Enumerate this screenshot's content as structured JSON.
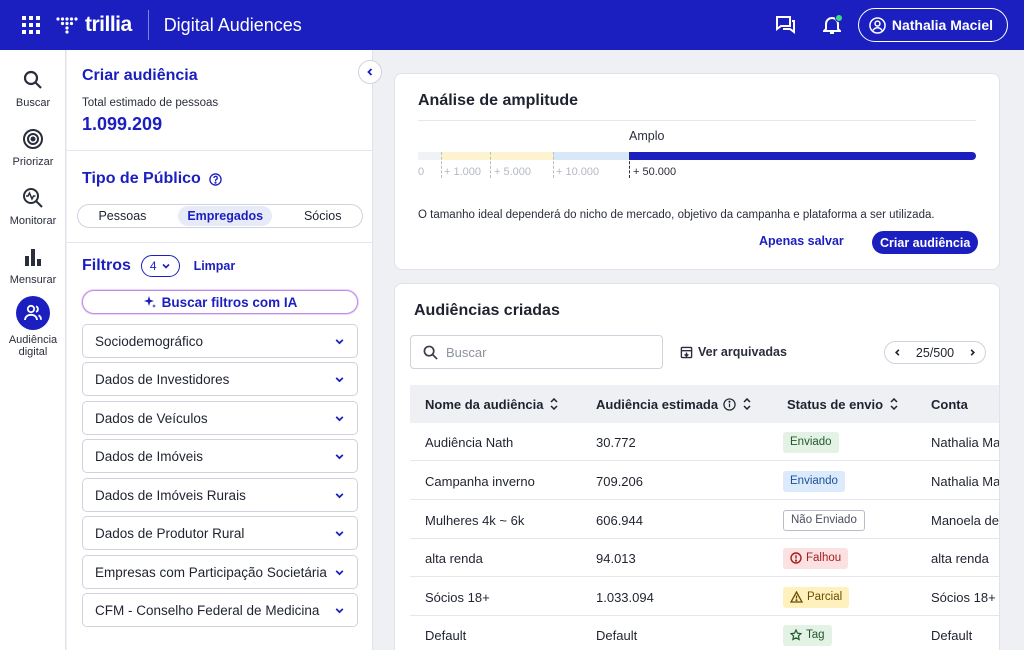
{
  "app": {
    "logo": "trillia",
    "title": "Digital Audiences",
    "user": "Nathalia Maciel"
  },
  "colors": {
    "brand": "#1b1fbf",
    "notification": "#3ddc84",
    "ai_border": "#c18be8"
  },
  "nav": [
    {
      "label": "Buscar",
      "icon": "search-icon"
    },
    {
      "label": "Priorizar",
      "icon": "target-icon"
    },
    {
      "label": "Monitorar",
      "icon": "monitor-icon"
    },
    {
      "label": "Mensurar",
      "icon": "bar-chart-icon"
    },
    {
      "label_line1": "Audiência",
      "label_line2": "digital",
      "icon": "people-icon",
      "active": true
    }
  ],
  "panel": {
    "title": "Criar audiência",
    "total_label": "Total estimado de pessoas",
    "total_value": "1.099.209",
    "tipo_title": "Tipo de Público",
    "tipo_options": [
      "Pessoas",
      "Empregados",
      "Sócios"
    ],
    "tipo_selected": "Empregados",
    "filtros_title": "Filtros",
    "filtros_count": "4",
    "limpar": "Limpar",
    "ai_button": "Buscar filtros com IA",
    "accordions": [
      "Sociodemográfico",
      "Dados de Investidores",
      "Dados de Veículos",
      "Dados de Imóveis",
      "Dados de Imóveis Rurais",
      "Dados de Produtor Rural",
      "Empresas com Participação Societária",
      "CFM - Conselho Federal de Medicina"
    ]
  },
  "amplitude": {
    "title": "Análise de amplitude",
    "level_label": "Amplo",
    "scale": [
      "0",
      "+ 1.000",
      "+ 5.000",
      "+ 10.000",
      "+ 50.000"
    ],
    "active_level": "+ 50.000",
    "note": "O tamanho ideal dependerá do nicho de mercado, objetivo da campanha e plataforma a ser utilizada.",
    "save_label": "Apenas salvar",
    "create_label": "Criar audiência"
  },
  "audiences": {
    "title": "Audiências criadas",
    "search_placeholder": "Buscar",
    "archived_label": "Ver arquivadas",
    "pagination": "25/500",
    "columns": [
      "Nome da audiência",
      "Audiência estimada",
      "Status de envio",
      "Conta"
    ],
    "rows": [
      {
        "name": "Audiência Nath",
        "estimate": "30.772",
        "status": "Enviado",
        "account": "Nathalia Maciel"
      },
      {
        "name": "Campanha inverno",
        "estimate": "709.206",
        "status": "Enviando",
        "account": "Nathalia Maciel"
      },
      {
        "name": "Mulheres 4k ~ 6k",
        "estimate": "606.944",
        "status": "Não Enviado",
        "account": "Manoela de Souza"
      },
      {
        "name": "alta renda",
        "estimate": "94.013",
        "status": "Falhou",
        "account": "alta renda"
      },
      {
        "name": "Sócios 18+",
        "estimate": "1.033.094",
        "status": "Parcial",
        "account": "Sócios 18+"
      },
      {
        "name": "Default",
        "estimate": "Default",
        "status": "Tag",
        "account": "Default"
      }
    ]
  }
}
